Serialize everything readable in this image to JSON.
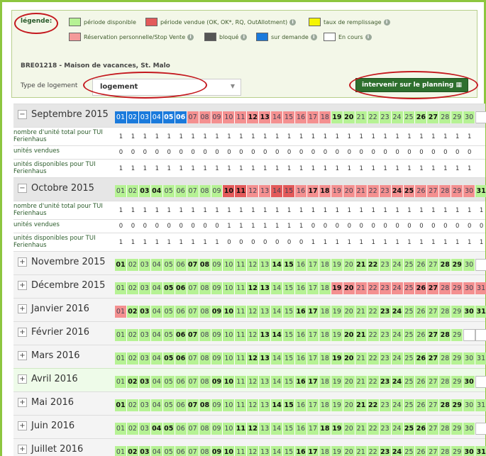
{
  "legend": {
    "title": "légende:",
    "items": [
      {
        "label": "période disponible",
        "color": "#b6f294"
      },
      {
        "label": "période vendue (OK, OK*, RQ, OutAllotment)",
        "color": "#e35a5a"
      },
      {
        "label": "taux de remplissage",
        "color": "#f5f500"
      },
      {
        "label": "Réservation personnelle/Stop Vente",
        "color": "#f49a9a"
      },
      {
        "label": "bloqué",
        "color": "#555555"
      },
      {
        "label": "sur demande",
        "color": "#1a7adc"
      },
      {
        "label": "En cours",
        "color": "#ffffff"
      }
    ],
    "property": "BRE01218 - Maison de vacances, St. Malo",
    "type_label": "Type de logement",
    "type_value": "logement",
    "button": "intervenir sur le planning"
  },
  "row_labels": {
    "total": "nombre d'unité total pour TUI Ferienhaus",
    "sold": "unités vendues",
    "avail": "unités disponibles pour TUI Ferienhaus"
  },
  "months": [
    {
      "name": "Septembre 2015",
      "expanded": true,
      "ndays": 30,
      "bold": [
        5,
        6,
        12,
        13,
        19,
        20,
        26,
        27
      ],
      "colors": {
        "1": "blue",
        "2": "blue",
        "3": "blue",
        "4": "blue",
        "5": "blue",
        "6": "blue",
        "7": "r",
        "8": "r",
        "9": "r",
        "10": "r",
        "11": "r",
        "12": "r",
        "13": "r",
        "14": "r",
        "15": "r",
        "16": "r",
        "17": "r",
        "18": "r"
      },
      "total": [
        1,
        1,
        1,
        1,
        1,
        1,
        1,
        1,
        1,
        1,
        1,
        1,
        1,
        1,
        1,
        1,
        1,
        1,
        1,
        1,
        1,
        1,
        1,
        1,
        1,
        1,
        1,
        1,
        1,
        1
      ],
      "sold": [
        0,
        0,
        0,
        0,
        0,
        0,
        0,
        0,
        0,
        0,
        0,
        0,
        0,
        0,
        0,
        0,
        0,
        0,
        0,
        0,
        0,
        0,
        0,
        0,
        0,
        0,
        0,
        0,
        0,
        0
      ],
      "avail": [
        1,
        1,
        1,
        1,
        1,
        1,
        1,
        1,
        1,
        1,
        1,
        1,
        1,
        1,
        1,
        1,
        1,
        1,
        1,
        1,
        1,
        1,
        1,
        1,
        1,
        1,
        1,
        1,
        1,
        1
      ]
    },
    {
      "name": "Octobre 2015",
      "expanded": true,
      "ndays": 31,
      "bold": [
        3,
        4,
        10,
        11,
        17,
        18,
        24,
        25,
        31
      ],
      "colors": {
        "10": "R",
        "11": "R",
        "12": "r",
        "13": "r",
        "14": "R",
        "15": "R",
        "16": "r",
        "17": "r",
        "18": "r",
        "19": "r",
        "20": "r",
        "21": "r",
        "22": "r",
        "23": "r",
        "24": "r",
        "25": "r",
        "26": "r",
        "27": "r",
        "28": "r",
        "29": "r",
        "30": "r"
      },
      "total": [
        1,
        1,
        1,
        1,
        1,
        1,
        1,
        1,
        1,
        1,
        1,
        1,
        1,
        1,
        1,
        1,
        1,
        1,
        1,
        1,
        1,
        1,
        1,
        1,
        1,
        1,
        1,
        1,
        1,
        1,
        1
      ],
      "sold": [
        0,
        0,
        0,
        0,
        0,
        0,
        0,
        0,
        0,
        1,
        1,
        1,
        1,
        1,
        1,
        1,
        0,
        0,
        0,
        0,
        0,
        0,
        0,
        0,
        0,
        0,
        0,
        0,
        0,
        0,
        0
      ],
      "avail": [
        1,
        1,
        1,
        1,
        1,
        1,
        1,
        1,
        1,
        0,
        0,
        0,
        0,
        0,
        0,
        0,
        1,
        1,
        1,
        1,
        1,
        1,
        1,
        1,
        1,
        1,
        1,
        1,
        1,
        1,
        1
      ]
    },
    {
      "name": "Novembre 2015",
      "expanded": false,
      "ndays": 30,
      "bold": [
        1,
        7,
        8,
        14,
        15,
        21,
        22,
        28,
        29
      ],
      "colors": {}
    },
    {
      "name": "Décembre 2015",
      "expanded": false,
      "ndays": 31,
      "bold": [
        5,
        6,
        12,
        13,
        19,
        20,
        26,
        27
      ],
      "colors": {
        "19": "r",
        "20": "r",
        "21": "r",
        "22": "r",
        "23": "r",
        "24": "r",
        "25": "r",
        "26": "r",
        "27": "r",
        "28": "r",
        "29": "r",
        "30": "r",
        "31": "r"
      }
    },
    {
      "name": "Janvier 2016",
      "expanded": false,
      "ndays": 31,
      "bold": [
        2,
        3,
        9,
        10,
        16,
        17,
        23,
        24,
        30,
        31
      ],
      "colors": {
        "1": "r"
      }
    },
    {
      "name": "Février 2016",
      "expanded": false,
      "ndays": 29,
      "bold": [
        6,
        7,
        13,
        14,
        20,
        21,
        27,
        28
      ],
      "colors": {}
    },
    {
      "name": "Mars 2016",
      "expanded": false,
      "ndays": 31,
      "bold": [
        5,
        6,
        12,
        13,
        19,
        20,
        26,
        27
      ],
      "colors": {}
    },
    {
      "name": "Avril 2016",
      "expanded": false,
      "ndays": 30,
      "bold": [
        2,
        3,
        9,
        10,
        16,
        17,
        23,
        24,
        30
      ],
      "colors": {},
      "green": true
    },
    {
      "name": "Mai 2016",
      "expanded": false,
      "ndays": 31,
      "bold": [
        1,
        7,
        8,
        14,
        15,
        21,
        22,
        28,
        29
      ],
      "colors": {}
    },
    {
      "name": "Juin 2016",
      "expanded": false,
      "ndays": 30,
      "bold": [
        4,
        5,
        11,
        12,
        18,
        19,
        25,
        26
      ],
      "colors": {}
    },
    {
      "name": "Juillet 2016",
      "expanded": false,
      "ndays": 31,
      "bold": [
        2,
        3,
        9,
        10,
        16,
        17,
        23,
        24,
        30,
        31
      ],
      "colors": {}
    }
  ]
}
